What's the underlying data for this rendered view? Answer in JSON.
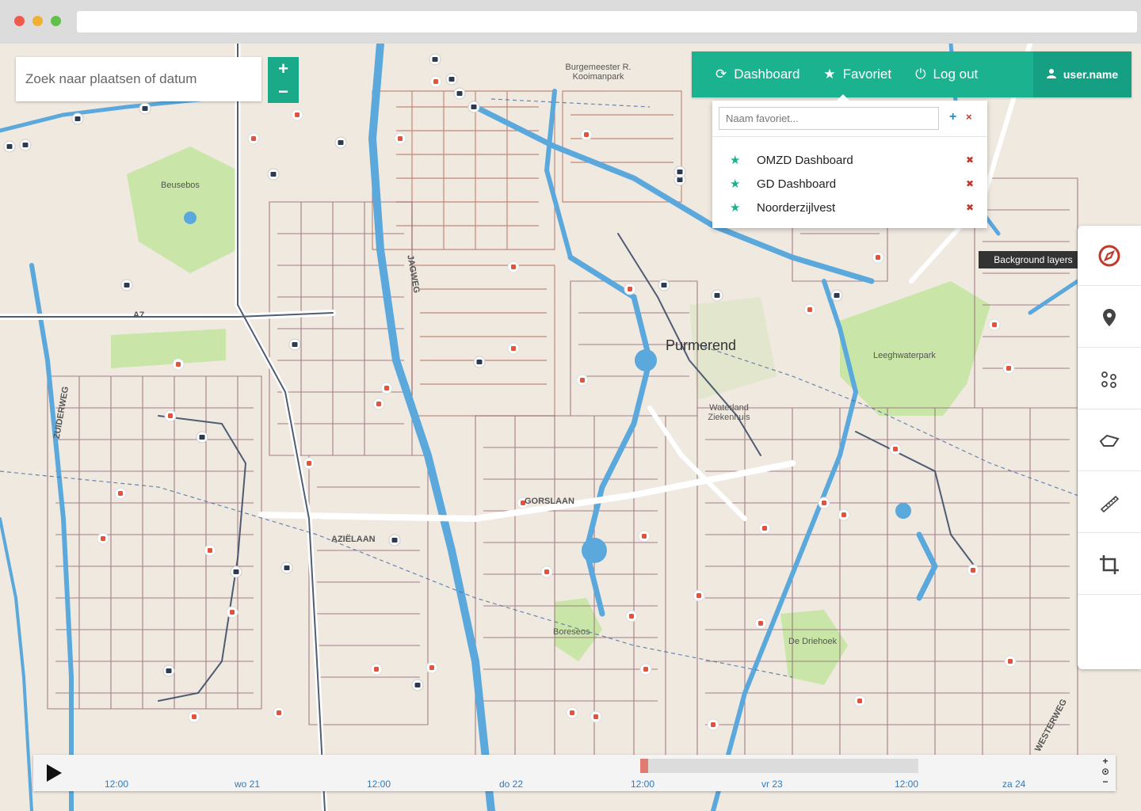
{
  "search": {
    "placeholder": "Zoek naar plaatsen of datum"
  },
  "zoom": {
    "in": "+",
    "out": "−"
  },
  "nav": {
    "dashboard": "Dashboard",
    "favoriet": "Favoriet",
    "logout": "Log out",
    "user": "user.name"
  },
  "favorites": {
    "input_placeholder": "Naam favoriet...",
    "add": "+",
    "clear": "×",
    "items": [
      {
        "label": "OMZD Dashboard"
      },
      {
        "label": "GD Dashboard"
      },
      {
        "label": "Noorderzijlvest"
      }
    ]
  },
  "tooltip": "Background layers",
  "right_panel": {
    "buttons": [
      "background-layers-icon",
      "location-pin-icon",
      "scatter-points-icon",
      "area-shape-icon",
      "ruler-icon",
      "crop-icon"
    ]
  },
  "timeline": {
    "labels": [
      "12:00",
      "wo 21",
      "12:00",
      "do 22",
      "12:00",
      "vr 23",
      "12:00",
      "za 24"
    ],
    "controls": {
      "zoom_in": "+",
      "reset": "⊙",
      "zoom_out": "−"
    }
  },
  "map": {
    "city": "Purmerend",
    "labels": [
      "Beusebos",
      "Leeghwaterpark",
      "Waterland Ziekenhuis",
      "Burgemeester R. Kooimanpark",
      "De Driehoek",
      "Boreseos",
      "A7",
      "ZUIDERWEG",
      "GORSLAAN",
      "AZIËLAAN",
      "JAGWEG",
      "WESTERWEG"
    ]
  },
  "colors": {
    "accent": "#1ab28f",
    "accent_dark": "#16a083",
    "danger": "#c0392b",
    "water": "#5aa8dc",
    "park": "#c9e6a8"
  }
}
